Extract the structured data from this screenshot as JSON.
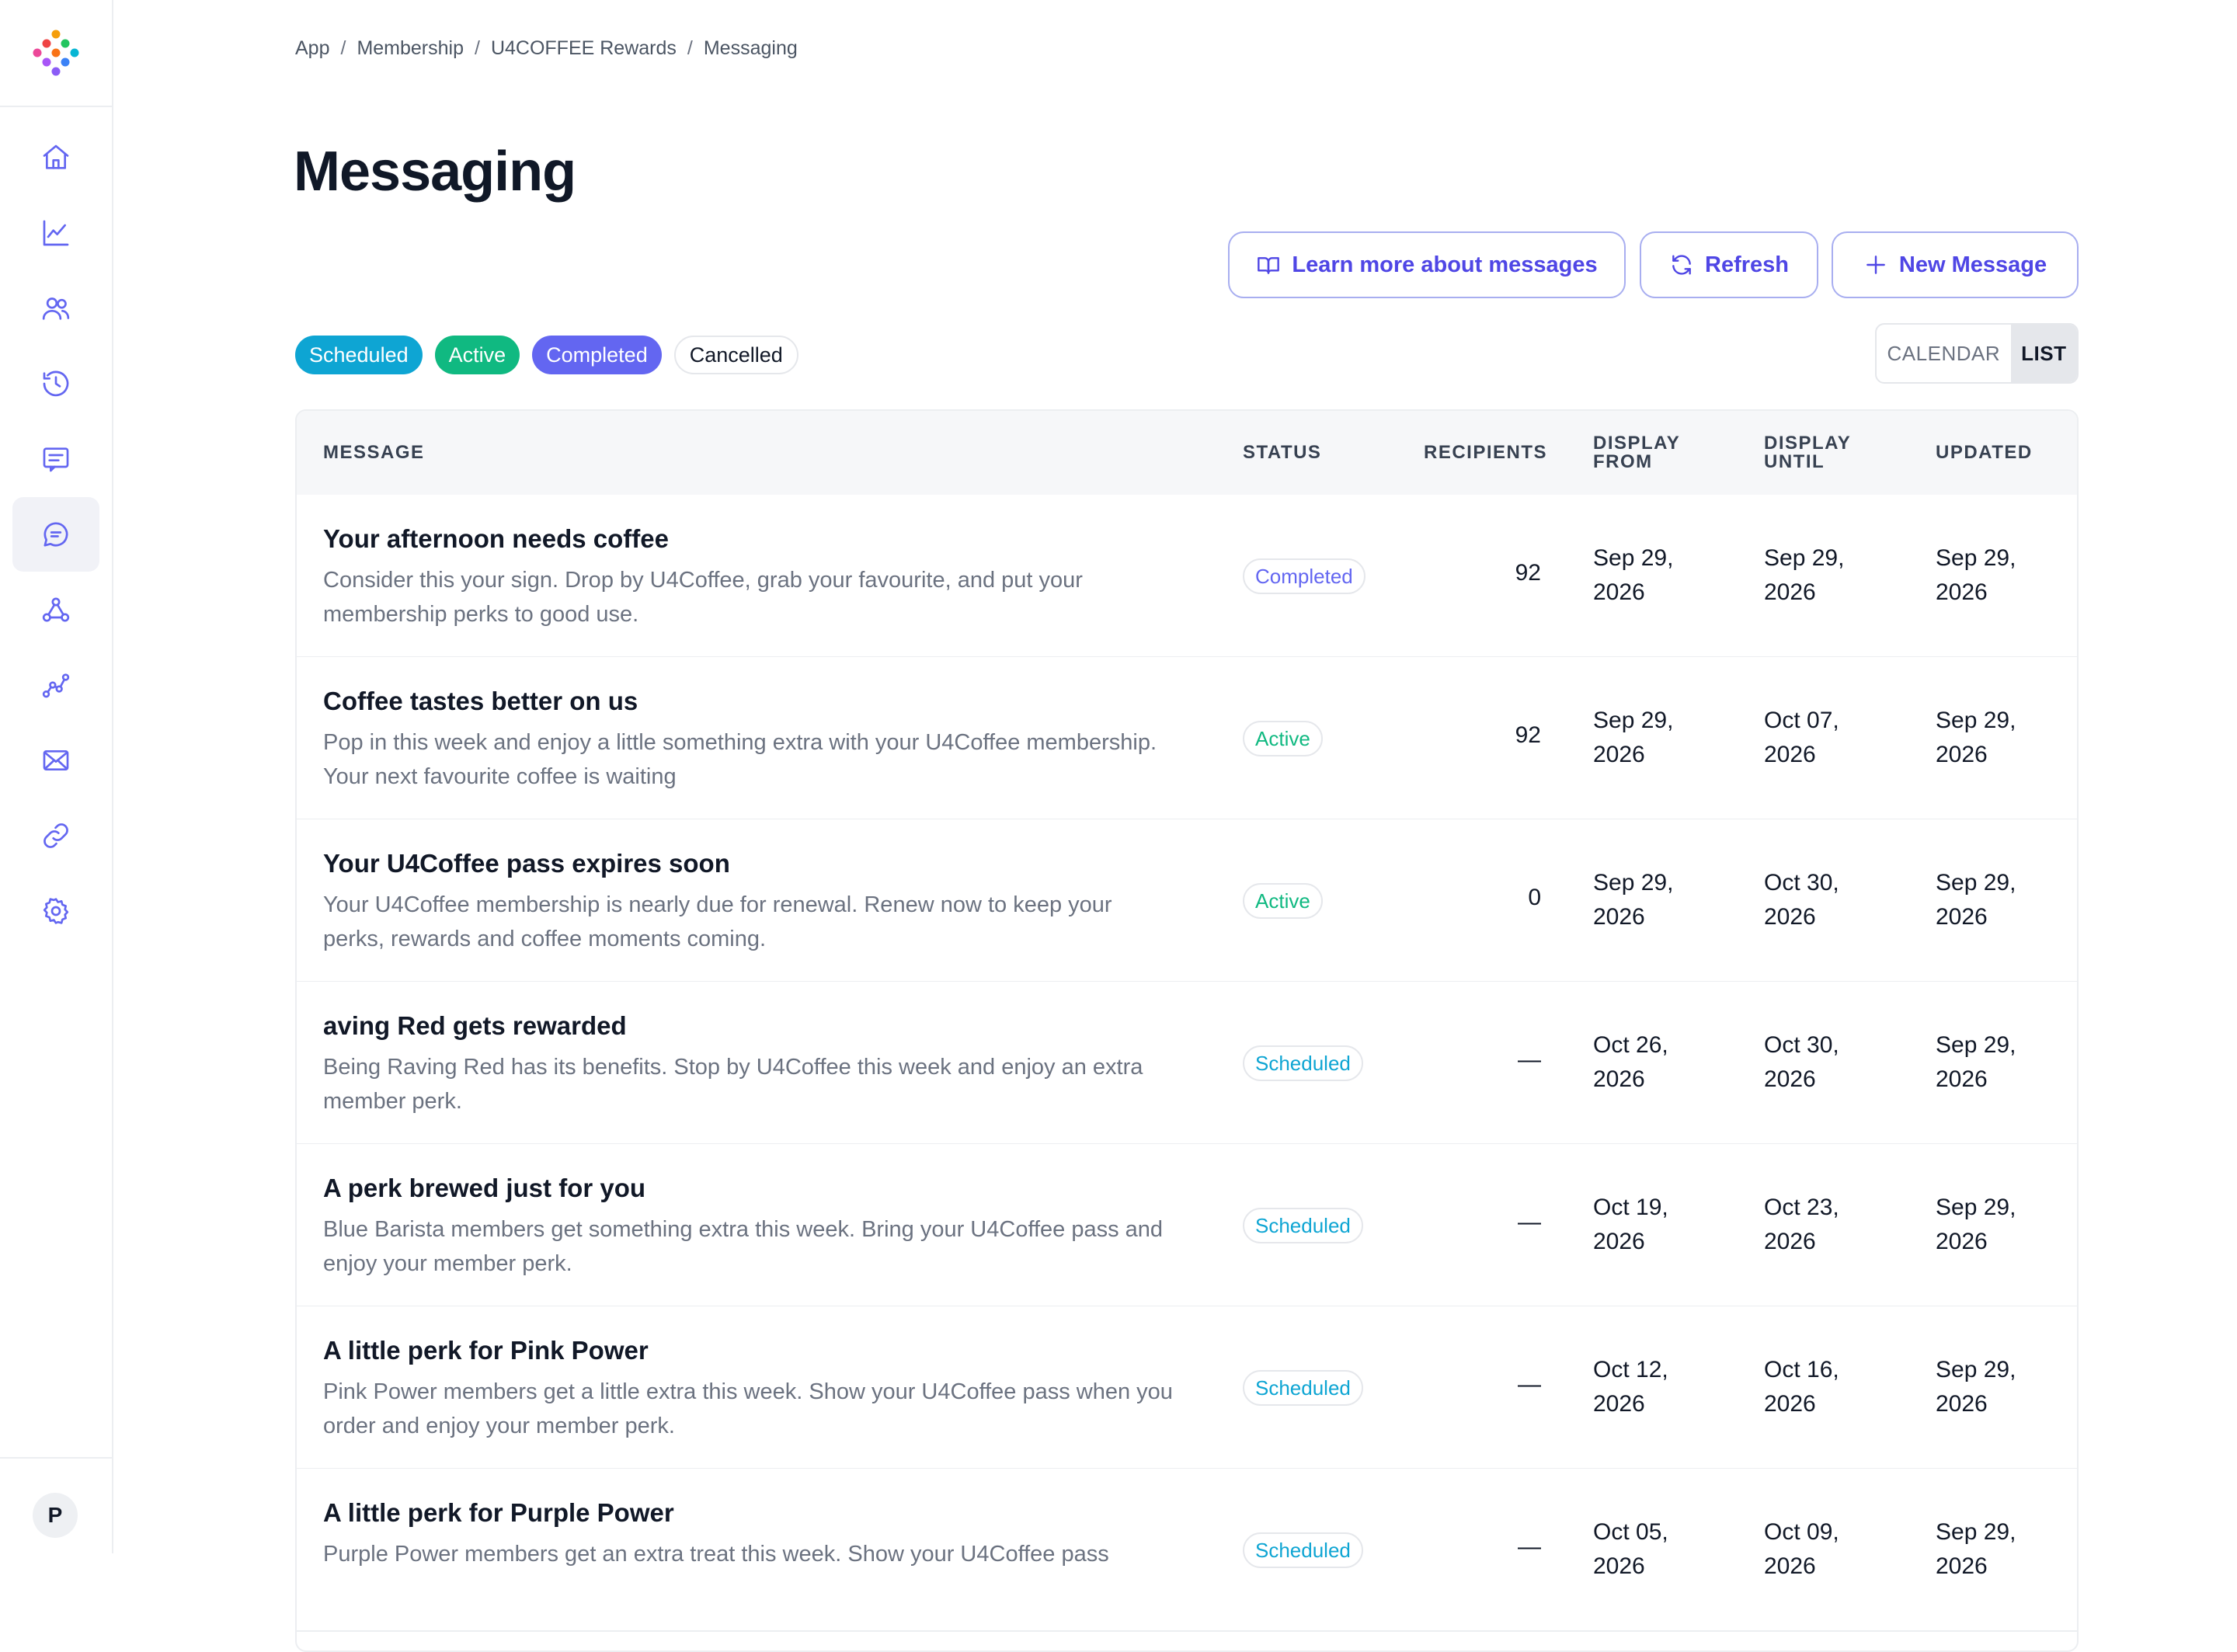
{
  "breadcrumb": [
    "App",
    "Membership",
    "U4COFFEE Rewards",
    "Messaging"
  ],
  "page_title": "Messaging",
  "actions": {
    "learn_more": "Learn more about messages",
    "refresh": "Refresh",
    "new_message": "New Message"
  },
  "filters": [
    "Scheduled",
    "Active",
    "Completed",
    "Cancelled"
  ],
  "view_toggle": {
    "calendar": "CALENDAR",
    "list": "LIST",
    "selected": "LIST"
  },
  "table": {
    "headers": {
      "message": "MESSAGE",
      "status": "STATUS",
      "recipients": "RECIPIENTS",
      "display_from": "DISPLAY FROM",
      "display_until": "DISPLAY UNTIL",
      "updated": "UPDATED"
    },
    "rows": [
      {
        "title": "Your afternoon needs coffee",
        "description": "Consider this your sign. Drop by U4Coffee, grab your favourite, and put your membership perks to good use.",
        "status": "Completed",
        "recipients": "92",
        "display_from": "Sep 29, 2026",
        "display_until": "Sep 29, 2026",
        "updated": "Sep 29, 2026"
      },
      {
        "title": "Coffee tastes better on us",
        "description": "Pop in this week and enjoy a little something extra with your U4Coffee membership. Your next favourite coffee is waiting",
        "status": "Active",
        "recipients": "92",
        "display_from": "Sep 29, 2026",
        "display_until": "Oct 07, 2026",
        "updated": "Sep 29, 2026"
      },
      {
        "title": "Your U4Coffee pass expires soon",
        "description": "Your U4Coffee membership is nearly due for renewal. Renew now to keep your perks, rewards and coffee moments coming.",
        "status": "Active",
        "recipients": "0",
        "display_from": "Sep 29, 2026",
        "display_until": "Oct 30, 2026",
        "updated": "Sep 29, 2026"
      },
      {
        "title": "aving Red gets rewarded",
        "description": "Being Raving Red has its benefits. Stop by U4Coffee this week and enjoy an extra member perk.",
        "status": "Scheduled",
        "recipients": "—",
        "display_from": "Oct 26, 2026",
        "display_until": "Oct 30, 2026",
        "updated": "Sep 29, 2026"
      },
      {
        "title": "A perk brewed just for you",
        "description": "Blue Barista members get something extra this week. Bring your U4Coffee pass and enjoy your member perk.",
        "status": "Scheduled",
        "recipients": "—",
        "display_from": "Oct 19, 2026",
        "display_until": "Oct 23, 2026",
        "updated": "Sep 29, 2026"
      },
      {
        "title": "A little perk for Pink Power",
        "description": "Pink Power members get a little extra this week. Show your U4Coffee pass when you order and enjoy your member perk.",
        "status": "Scheduled",
        "recipients": "—",
        "display_from": "Oct 12, 2026",
        "display_until": "Oct 16, 2026",
        "updated": "Sep 29, 2026"
      },
      {
        "title": "A little perk for Purple Power",
        "description": "Purple Power members get an extra treat this week. Show your U4Coffee pass",
        "status": "Scheduled",
        "recipients": "—",
        "display_from": "Oct 05, 2026",
        "display_until": "Oct 09, 2026",
        "updated": "Sep 29, 2026"
      }
    ]
  },
  "user": {
    "avatar_initial": "P"
  },
  "sidebar": {
    "icons": [
      "home-icon",
      "chart-line-icon",
      "users-icon",
      "history-icon",
      "message-square-icon",
      "chat-bubble-icon",
      "webhook-icon",
      "analytics-icon",
      "mail-icon",
      "link-icon",
      "gear-icon"
    ],
    "active": "chat-bubble-icon"
  },
  "colors": {
    "accent": "#4f46e5",
    "scheduled": "#0ea5d3",
    "active": "#10b981",
    "completed": "#6366f1",
    "sidebar_icon": "#6366f1"
  }
}
